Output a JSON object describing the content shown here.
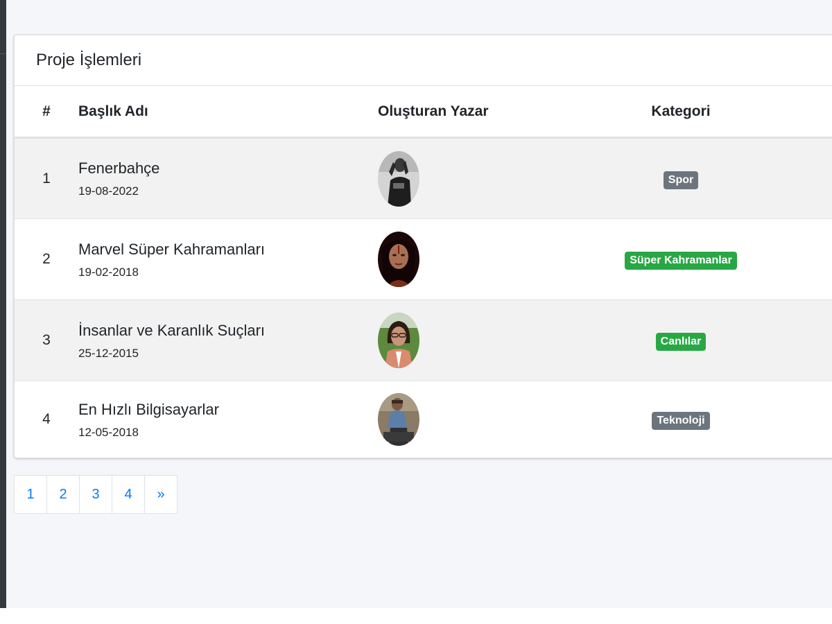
{
  "card": {
    "title": "Proje İşlemleri"
  },
  "table": {
    "headers": {
      "num": "#",
      "title": "Başlık Adı",
      "author": "Oluşturan Yazar",
      "category": "Kategori"
    },
    "rows": [
      {
        "num": "1",
        "title": "Fenerbahçe",
        "date": "19-08-2022",
        "category": "Spor",
        "category_color": "#6c757d"
      },
      {
        "num": "2",
        "title": "Marvel Süper Kahramanları",
        "date": "19-02-2018",
        "category": "Süper Kahramanlar",
        "category_color": "#28a745"
      },
      {
        "num": "3",
        "title": "İnsanlar ve Karanlık Suçları",
        "date": "25-12-2015",
        "category": "Canlılar",
        "category_color": "#28a745"
      },
      {
        "num": "4",
        "title": "En Hızlı Bilgisayarlar",
        "date": "12-05-2018",
        "category": "Teknoloji",
        "category_color": "#6c757d"
      }
    ]
  },
  "pagination": {
    "pages": [
      "1",
      "2",
      "3",
      "4"
    ],
    "next": "»"
  },
  "colors": {
    "link": "#007bff",
    "badge_secondary": "#6c757d",
    "badge_success": "#28a745",
    "sidebar": "#343a40",
    "content_bg": "#f4f6f9"
  }
}
